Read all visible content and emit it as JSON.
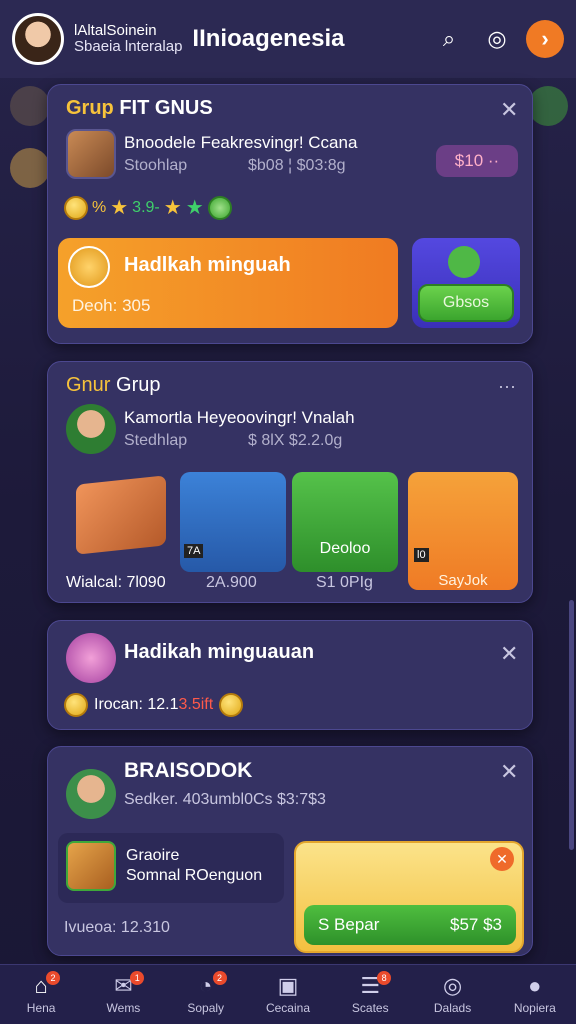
{
  "header": {
    "name": "lAltalSoinein",
    "subtitle": "Sbaeia lnteralap",
    "title": "IInioagenesia",
    "icons": [
      "search-icon",
      "chat-icon",
      "forward-icon"
    ]
  },
  "card1": {
    "title_yellow": "Grup",
    "title_white": "FIT GNUS",
    "item_title": "Bnoodele Feakresvingr! Ccana",
    "item_sub": "Stoohlap",
    "item_price": "$b08 ¦ $03:8g",
    "price_pill": "$10 ··",
    "rating_a": "%",
    "rating_b": "3.9-",
    "orange_title": "Hadlkah minguah",
    "orange_sub": "Deoh: 305",
    "green_btn": "Gbsos"
  },
  "card2": {
    "title_yellow": "Gnur",
    "title_white": "Grup",
    "more": "···",
    "item_title": "Kamortla Heyeoovingr! Vnalah",
    "item_sub": "Stedhlap",
    "item_price": "$ 8lX $2.2.0g",
    "tiles": [
      {
        "label": "Wialcal: 7l090",
        "badge": ""
      },
      {
        "label": "2A.900",
        "badge": "7A"
      },
      {
        "label": "S1 0PIg",
        "badge": "",
        "inner": "Deoloo"
      },
      {
        "label": "SayJok",
        "badge": "l0"
      }
    ]
  },
  "card3": {
    "title": "Hadikah minguauan",
    "amount_label": "Irocan: 12.1",
    "amount_red": "3.5ift"
  },
  "card4": {
    "title": "BRAISODOK",
    "sub": "Sedker. 403umbl0Cs $3:7$3",
    "left_title": "Graoire",
    "left_sub": "Somnal ROenguon",
    "price_line": "Ivueoa: 12.310",
    "bar_left": "S Bepar",
    "bar_right": "$57 $3"
  },
  "nav": {
    "items": [
      {
        "label": "Hena",
        "icon": "home-icon",
        "badge": "2"
      },
      {
        "label": "Wems",
        "icon": "chat-icon",
        "badge": "1"
      },
      {
        "label": "Sopaly",
        "icon": "spin-icon",
        "badge": "2"
      },
      {
        "label": "Cecaina",
        "icon": "wallet-icon",
        "badge": ""
      },
      {
        "label": "Scates",
        "icon": "list-icon",
        "badge": "8"
      },
      {
        "label": "Dalads",
        "icon": "compass-icon",
        "badge": ""
      },
      {
        "label": "Nopiera",
        "icon": "profile-icon",
        "badge": ""
      }
    ]
  },
  "colors": {
    "accent": "#f07a24",
    "card": "#353263",
    "bg": "#1f1c3e",
    "green": "#3ba52e",
    "gold": "#f7c33b"
  }
}
